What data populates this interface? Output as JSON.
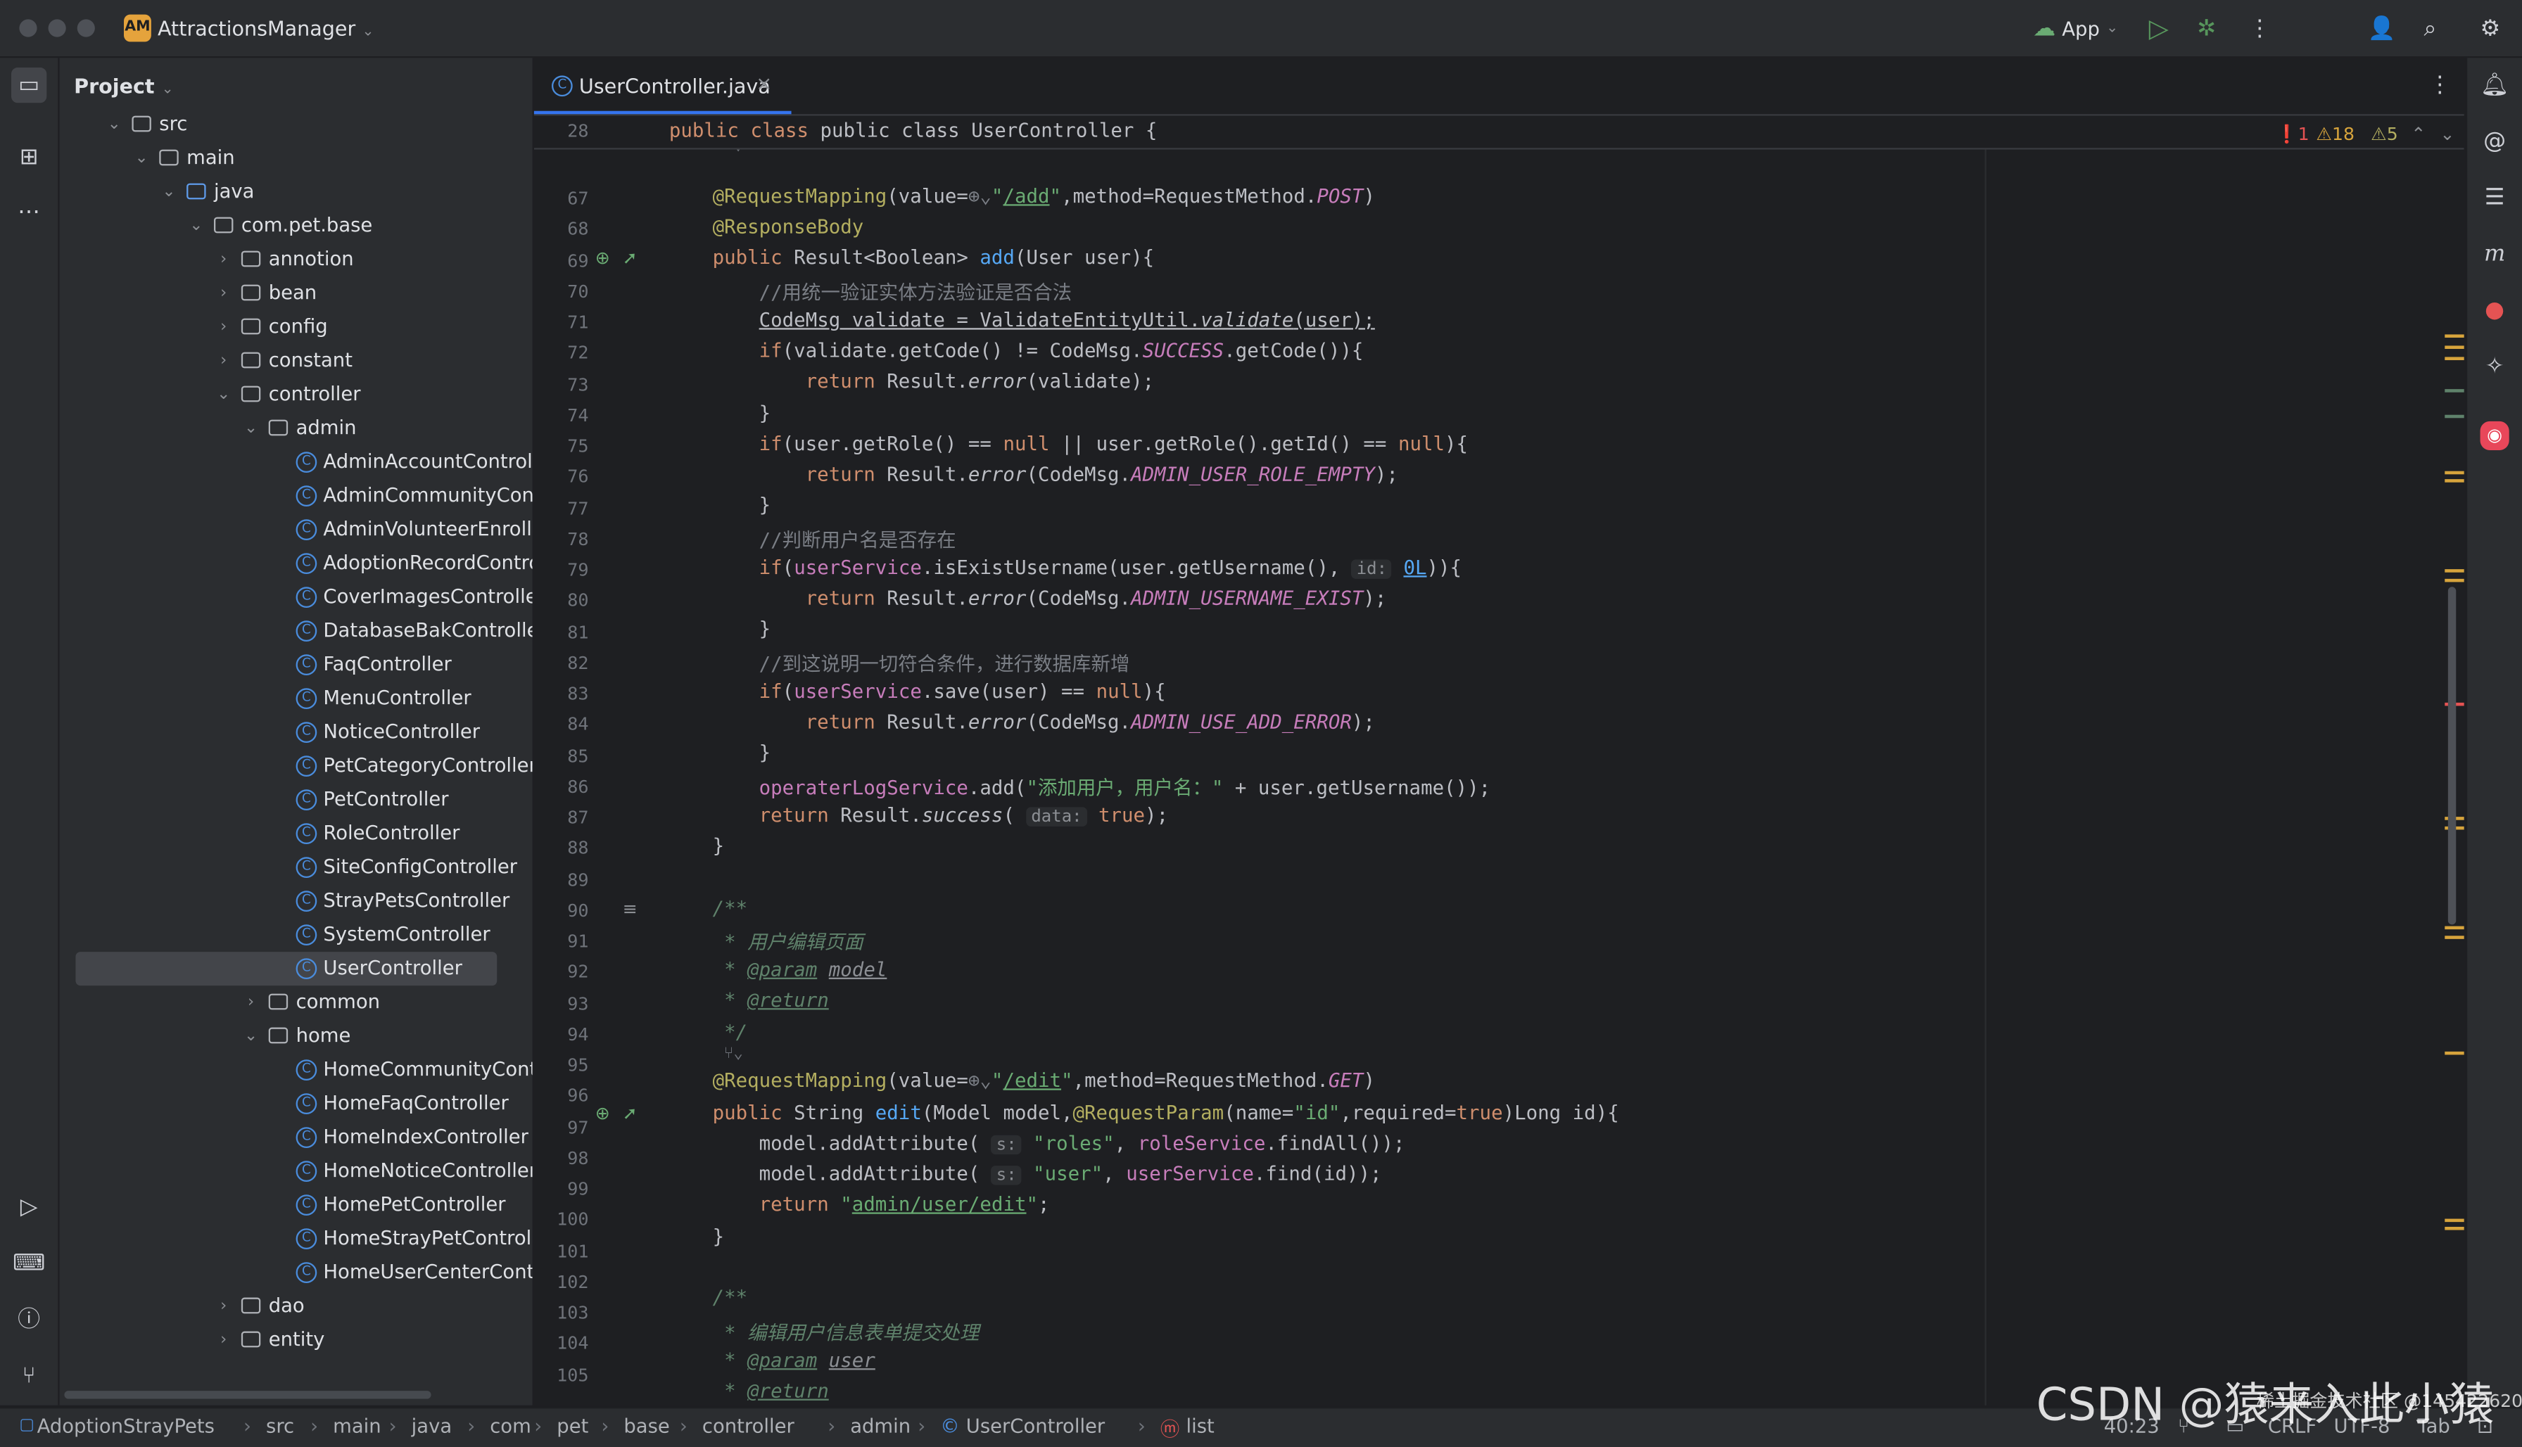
{
  "window": {
    "project_badge": "AM",
    "project_name": "AttractionsManager",
    "run_config": "App"
  },
  "project_panel": {
    "title": "Project",
    "tree": [
      {
        "label": "src",
        "depth": 0,
        "kind": "folder",
        "open": true
      },
      {
        "label": "main",
        "depth": 1,
        "kind": "folder",
        "open": true
      },
      {
        "label": "java",
        "depth": 2,
        "kind": "src-folder",
        "open": true
      },
      {
        "label": "com.pet.base",
        "depth": 3,
        "kind": "package",
        "open": true
      },
      {
        "label": "annotion",
        "depth": 4,
        "kind": "package",
        "open": false
      },
      {
        "label": "bean",
        "depth": 4,
        "kind": "package",
        "open": false
      },
      {
        "label": "config",
        "depth": 4,
        "kind": "package",
        "open": false
      },
      {
        "label": "constant",
        "depth": 4,
        "kind": "package",
        "open": false
      },
      {
        "label": "controller",
        "depth": 4,
        "kind": "package",
        "open": true
      },
      {
        "label": "admin",
        "depth": 5,
        "kind": "package",
        "open": true
      },
      {
        "label": "AdminAccountControlle",
        "depth": 6,
        "kind": "class"
      },
      {
        "label": "AdminCommunityContr",
        "depth": 6,
        "kind": "class"
      },
      {
        "label": "AdminVolunteerEnrollC",
        "depth": 6,
        "kind": "class"
      },
      {
        "label": "AdoptionRecordContro",
        "depth": 6,
        "kind": "class"
      },
      {
        "label": "CoverImagesController",
        "depth": 6,
        "kind": "class"
      },
      {
        "label": "DatabaseBakController",
        "depth": 6,
        "kind": "class"
      },
      {
        "label": "FaqController",
        "depth": 6,
        "kind": "class"
      },
      {
        "label": "MenuController",
        "depth": 6,
        "kind": "class"
      },
      {
        "label": "NoticeController",
        "depth": 6,
        "kind": "class"
      },
      {
        "label": "PetCategoryController",
        "depth": 6,
        "kind": "class"
      },
      {
        "label": "PetController",
        "depth": 6,
        "kind": "class"
      },
      {
        "label": "RoleController",
        "depth": 6,
        "kind": "class"
      },
      {
        "label": "SiteConfigController",
        "depth": 6,
        "kind": "class"
      },
      {
        "label": "StrayPetsController",
        "depth": 6,
        "kind": "class"
      },
      {
        "label": "SystemController",
        "depth": 6,
        "kind": "class"
      },
      {
        "label": "UserController",
        "depth": 6,
        "kind": "class",
        "selected": true
      },
      {
        "label": "common",
        "depth": 5,
        "kind": "package",
        "open": false
      },
      {
        "label": "home",
        "depth": 5,
        "kind": "package",
        "open": true
      },
      {
        "label": "HomeCommunityContr",
        "depth": 6,
        "kind": "class"
      },
      {
        "label": "HomeFaqController",
        "depth": 6,
        "kind": "class"
      },
      {
        "label": "HomeIndexController",
        "depth": 6,
        "kind": "class"
      },
      {
        "label": "HomeNoticeController",
        "depth": 6,
        "kind": "class"
      },
      {
        "label": "HomePetController",
        "depth": 6,
        "kind": "class"
      },
      {
        "label": "HomeStrayPetControlle",
        "depth": 6,
        "kind": "class"
      },
      {
        "label": "HomeUserCenterContr",
        "depth": 6,
        "kind": "class"
      },
      {
        "label": "dao",
        "depth": 4,
        "kind": "package",
        "open": false
      },
      {
        "label": "entity",
        "depth": 4,
        "kind": "package",
        "open": false
      }
    ]
  },
  "editor": {
    "tab_title": "UserController.java",
    "sticky_line_no": "28",
    "sticky_line": "public class UserController {",
    "inspections": {
      "errors": "1",
      "warnings": "18",
      "weak": "5"
    },
    "line_numbers": [
      "67",
      "68",
      "69",
      "70",
      "71",
      "72",
      "73",
      "74",
      "75",
      "76",
      "77",
      "78",
      "79",
      "80",
      "81",
      "82",
      "83",
      "84",
      "85",
      "86",
      "87",
      "88",
      "89",
      "90",
      "91",
      "92",
      "93",
      "94",
      "95",
      "96",
      "97",
      "98",
      "99",
      "100",
      "101",
      "102",
      "103",
      "104",
      "105"
    ]
  },
  "statusbar": {
    "breadcrumbs": [
      "AdoptionStrayPets",
      "src",
      "main",
      "java",
      "com",
      "pet",
      "base",
      "controller",
      "admin",
      "UserController",
      "list"
    ],
    "position": "40:23",
    "line_sep": "CRLF",
    "encoding": "UTF-8",
    "indent": "Tab"
  },
  "watermark": {
    "main": "CSDN @猿来入此小猿",
    "small": "稀土掘金技术社区 @145422620"
  }
}
